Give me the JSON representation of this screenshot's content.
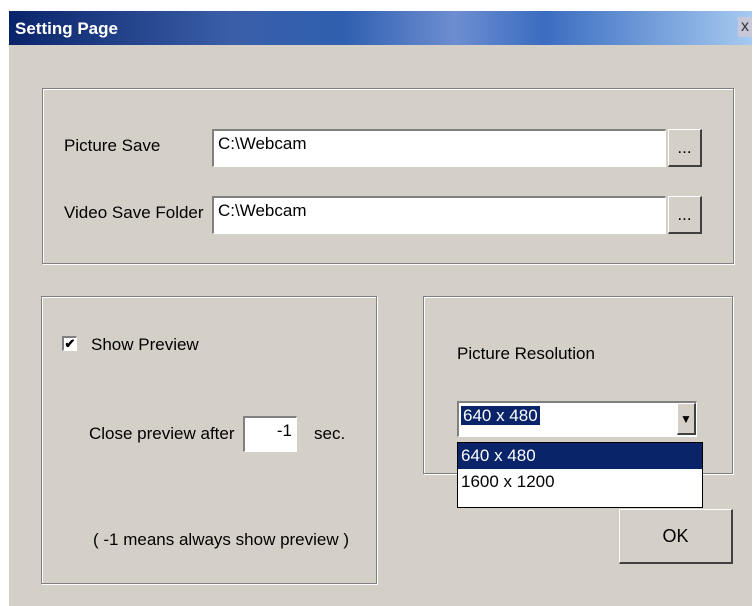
{
  "window": {
    "title": "Setting Page",
    "close_label": "x"
  },
  "folders": {
    "picture_save_label": "Picture Save",
    "picture_save_value": "C:\\Webcam",
    "video_save_label": "Video Save Folder",
    "video_save_value": "C:\\Webcam",
    "browse_label": "..."
  },
  "preview": {
    "show_preview_label": "Show Preview",
    "show_preview_checked": true,
    "check_mark": "✔",
    "close_after_label": "Close preview after",
    "close_after_value": "-1",
    "sec_label": "sec.",
    "hint": "( -1 means always show preview )"
  },
  "resolution": {
    "label": "Picture Resolution",
    "selected": "640 x 480",
    "options": [
      "640 x 480",
      "1600 x 1200"
    ],
    "arrow": "▼"
  },
  "ok_label": "OK"
}
